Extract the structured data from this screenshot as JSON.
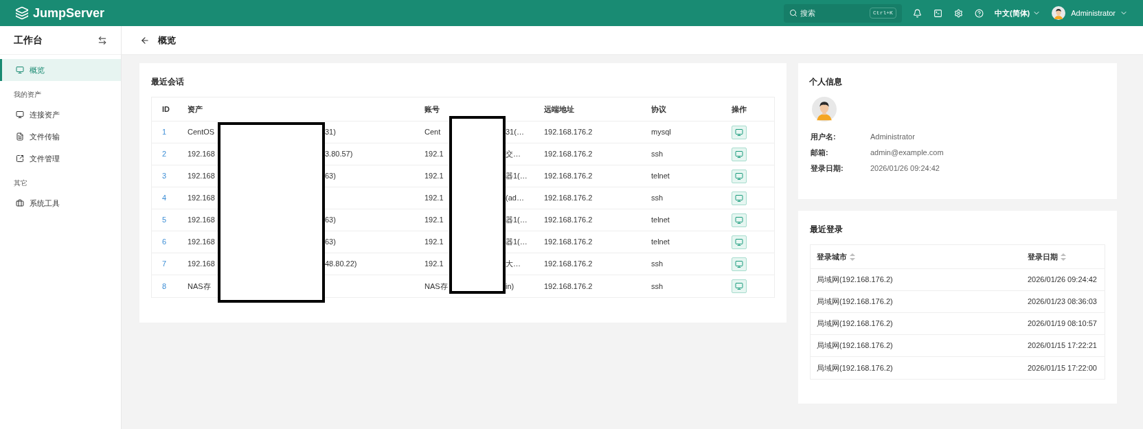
{
  "topbar": {
    "brand": "JumpServer",
    "search": {
      "placeholder": "搜索",
      "shortcut": "Ctrl+K"
    },
    "language": "中文(简体)",
    "user": "Administrator"
  },
  "sidebar": {
    "title": "工作台",
    "items": [
      {
        "kind": "item",
        "label": "概览",
        "selected": true
      },
      {
        "kind": "group",
        "label": "我的资产"
      },
      {
        "kind": "item",
        "label": "连接资产",
        "selected": false
      },
      {
        "kind": "item",
        "label": "文件传输",
        "selected": false
      },
      {
        "kind": "item",
        "label": "文件管理",
        "selected": false
      },
      {
        "kind": "group",
        "label": "其它"
      },
      {
        "kind": "item",
        "label": "系统工具",
        "selected": false
      }
    ]
  },
  "breadcrumb": "概览",
  "recent_sessions": {
    "title": "最近会话",
    "columns": [
      "ID",
      "资产",
      "账号",
      "远端地址",
      "协议",
      "操作"
    ],
    "rows": [
      {
        "id": "1",
        "asset_start": "CentOS",
        "asset_end": "31)",
        "account_start": "Cent",
        "account_end": "31(…",
        "address": "192.168.176.2",
        "protocol": "mysql"
      },
      {
        "id": "2",
        "asset_start": "192.168",
        "asset_end": "3.80.57)",
        "account_start": "192.1",
        "account_end": "交…",
        "address": "192.168.176.2",
        "protocol": "ssh"
      },
      {
        "id": "3",
        "asset_start": "192.168",
        "asset_end": "63)",
        "account_start": "192.1",
        "account_end": "器1(…",
        "address": "192.168.176.2",
        "protocol": "telnet"
      },
      {
        "id": "4",
        "asset_start": "192.168",
        "account_start": "192.1",
        "account_end": "(ad…",
        "address": "192.168.176.2",
        "protocol": "ssh"
      },
      {
        "id": "5",
        "asset_start": "192.168",
        "asset_end": "63)",
        "account_start": "192.1",
        "account_end": "器1(…",
        "address": "192.168.176.2",
        "protocol": "telnet"
      },
      {
        "id": "6",
        "asset_start": "192.168",
        "asset_end": "63)",
        "account_start": "192.1",
        "account_end": "器1(…",
        "address": "192.168.176.2",
        "protocol": "telnet"
      },
      {
        "id": "7",
        "asset_start": "192.168",
        "asset_end": "48.80.22)",
        "account_start": "192.1",
        "account_end": "大…",
        "address": "192.168.176.2",
        "protocol": "ssh"
      },
      {
        "id": "8",
        "asset_start": "NAS存",
        "account_start": "NAS存",
        "account_end": "in)",
        "address": "192.168.176.2",
        "protocol": "ssh"
      }
    ]
  },
  "personal_info": {
    "title": "个人信息",
    "fields": [
      {
        "label": "用户名:",
        "value": "Administrator"
      },
      {
        "label": "邮箱:",
        "value": "admin@example.com"
      },
      {
        "label": "登录日期:",
        "value": "2026/01/26 09:24:42"
      }
    ]
  },
  "recent_logins": {
    "title": "最近登录",
    "columns": [
      "登录城市",
      "登录日期"
    ],
    "rows": [
      {
        "city": "局域网(192.168.176.2)",
        "date": "2026/01/26 09:24:42"
      },
      {
        "city": "局域网(192.168.176.2)",
        "date": "2026/01/23 08:36:03"
      },
      {
        "city": "局域网(192.168.176.2)",
        "date": "2026/01/19 08:10:57"
      },
      {
        "city": "局域网(192.168.176.2)",
        "date": "2026/01/15 17:22:21"
      },
      {
        "city": "局域网(192.168.176.2)",
        "date": "2026/01/15 17:22:00"
      }
    ]
  }
}
